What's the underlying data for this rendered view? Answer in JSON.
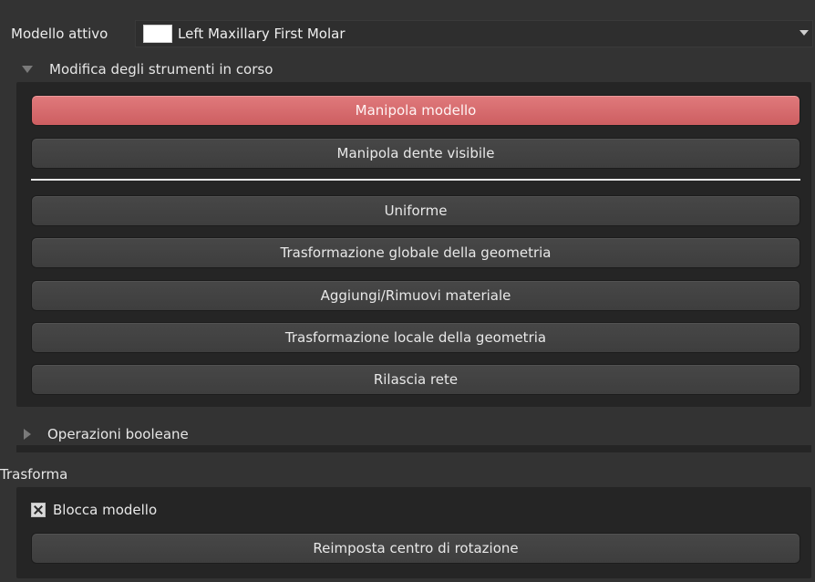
{
  "model_row": {
    "label": "Modello attivo",
    "selected_model": "Left Maxillary First Molar",
    "swatch_color": "#ffffff"
  },
  "tool_section": {
    "title": "Modifica degli strumenti in corso",
    "expanded": true,
    "primary_buttons": [
      {
        "label": "Manipola modello",
        "active": true
      },
      {
        "label": "Manipola dente visibile",
        "active": false
      }
    ],
    "secondary_buttons": [
      {
        "label": "Uniforme"
      },
      {
        "label": "Trasformazione globale della geometria"
      },
      {
        "label": "Aggiungi/Rimuovi materiale"
      },
      {
        "label": "Trasformazione locale della geometria"
      },
      {
        "label": "Rilascia rete"
      }
    ]
  },
  "boolean_section": {
    "title": "Operazioni booleane",
    "expanded": false
  },
  "transform_section": {
    "title": "Trasforma",
    "lock_checkbox_label": "Blocca modello",
    "lock_checked": true,
    "reset_button_label": "Reimposta centro di rotazione"
  },
  "colors": {
    "active_button": "#d9686b",
    "panel_bg": "#333333",
    "group_bg": "#252525"
  }
}
